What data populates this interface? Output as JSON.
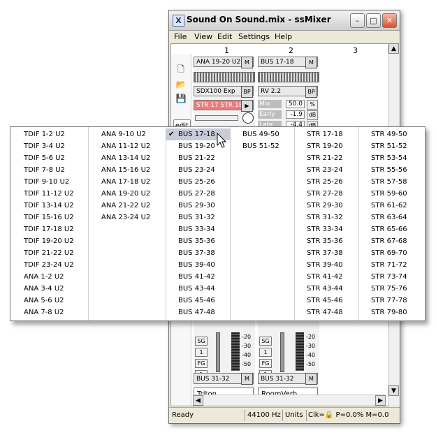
{
  "window": {
    "title": "Sound On Sound.mix - ssMixer",
    "app_icon_glyph": "X"
  },
  "menu": [
    "File",
    "Edit",
    "Settings",
    "Help"
  ],
  "menu_view": "View",
  "columns": [
    "1",
    "2",
    "3"
  ],
  "toolbar": {
    "edit_label": "edit"
  },
  "strip1": {
    "input": "ANA 19-20 U2",
    "input_btn": "M",
    "plugin": "SDX100 Exp",
    "plugin_btn": "BP",
    "send": "STR 17 STR 18",
    "send_btn": "▶",
    "meter_labels": [
      "SG",
      "1",
      "FG",
      "1"
    ],
    "output": "BUS 31-32",
    "output_btn": "M",
    "name": "Triton",
    "scale": [
      "-20",
      "-30",
      "-40",
      "-50"
    ]
  },
  "strip2": {
    "input": "BUS 17-18",
    "input_btn": "M",
    "plugin": "RV 2.2",
    "plugin_btn": "BP",
    "params": [
      {
        "label": "Mix",
        "value": "50.0",
        "unit": "%"
      },
      {
        "label": "Early",
        "value": "-1.9",
        "unit": "dB"
      },
      {
        "label": "Late",
        "value": "-4.4",
        "unit": "dB"
      }
    ],
    "meter_labels": [
      "SG",
      "1",
      "FG",
      "1"
    ],
    "output": "BUS 31-32",
    "output_btn": "M",
    "name": "RoomVerb",
    "scale": [
      "-20",
      "-30",
      "-40",
      "-50"
    ]
  },
  "status": {
    "ready": "Ready",
    "rate": "44100 Hz",
    "units": "Units",
    "clock": "Clk=🔒 P=0.0% M=0.0"
  },
  "popup": {
    "selected": "BUS 17-18",
    "columns": [
      [
        "TDIF 1-2 U2",
        "TDIF 3-4 U2",
        "TDIF 5-6 U2",
        "TDIF 7-8 U2",
        "TDIF 9-10 U2",
        "TDIF 11-12 U2",
        "TDIF 13-14 U2",
        "TDIF 15-16 U2",
        "TDIF 17-18 U2",
        "TDIF 19-20 U2",
        "TDIF 21-22 U2",
        "TDIF 23-24 U2",
        "ANA 1-2 U2",
        "ANA 3-4 U2",
        "ANA 5-6 U2",
        "ANA 7-8 U2"
      ],
      [
        "ANA 9-10 U2",
        "ANA 11-12 U2",
        "ANA 13-14 U2",
        "ANA 15-16 U2",
        "ANA 17-18 U2",
        "ANA 19-20 U2",
        "ANA 21-22 U2",
        "ANA 23-24 U2"
      ],
      [
        "BUS 17-18",
        "BUS 19-20",
        "BUS 21-22",
        "BUS 23-24",
        "BUS 25-26",
        "BUS 27-28",
        "BUS 29-30",
        "BUS 31-32",
        "BUS 33-34",
        "BUS 35-36",
        "BUS 37-38",
        "BUS 39-40",
        "BUS 41-42",
        "BUS 43-44",
        "BUS 45-46",
        "BUS 47-48"
      ],
      [
        "BUS 49-50",
        "BUS 51-52"
      ],
      [
        "STR 17-18",
        "STR 19-20",
        "STR 21-22",
        "STR 23-24",
        "STR 25-26",
        "STR 27-28",
        "STR 29-30",
        "STR 31-32",
        "STR 33-34",
        "STR 35-36",
        "STR 37-38",
        "STR 39-40",
        "STR 41-42",
        "STR 43-44",
        "STR 45-46",
        "STR 47-48"
      ],
      [
        "STR 49-50",
        "STR 51-52",
        "STR 53-54",
        "STR 55-56",
        "STR 57-58",
        "STR 59-60",
        "STR 61-62",
        "STR 63-64",
        "STR 65-66",
        "STR 67-68",
        "STR 69-70",
        "STR 71-72",
        "STR 73-74",
        "STR 75-76",
        "STR 77-78",
        "STR 79-80"
      ]
    ]
  }
}
